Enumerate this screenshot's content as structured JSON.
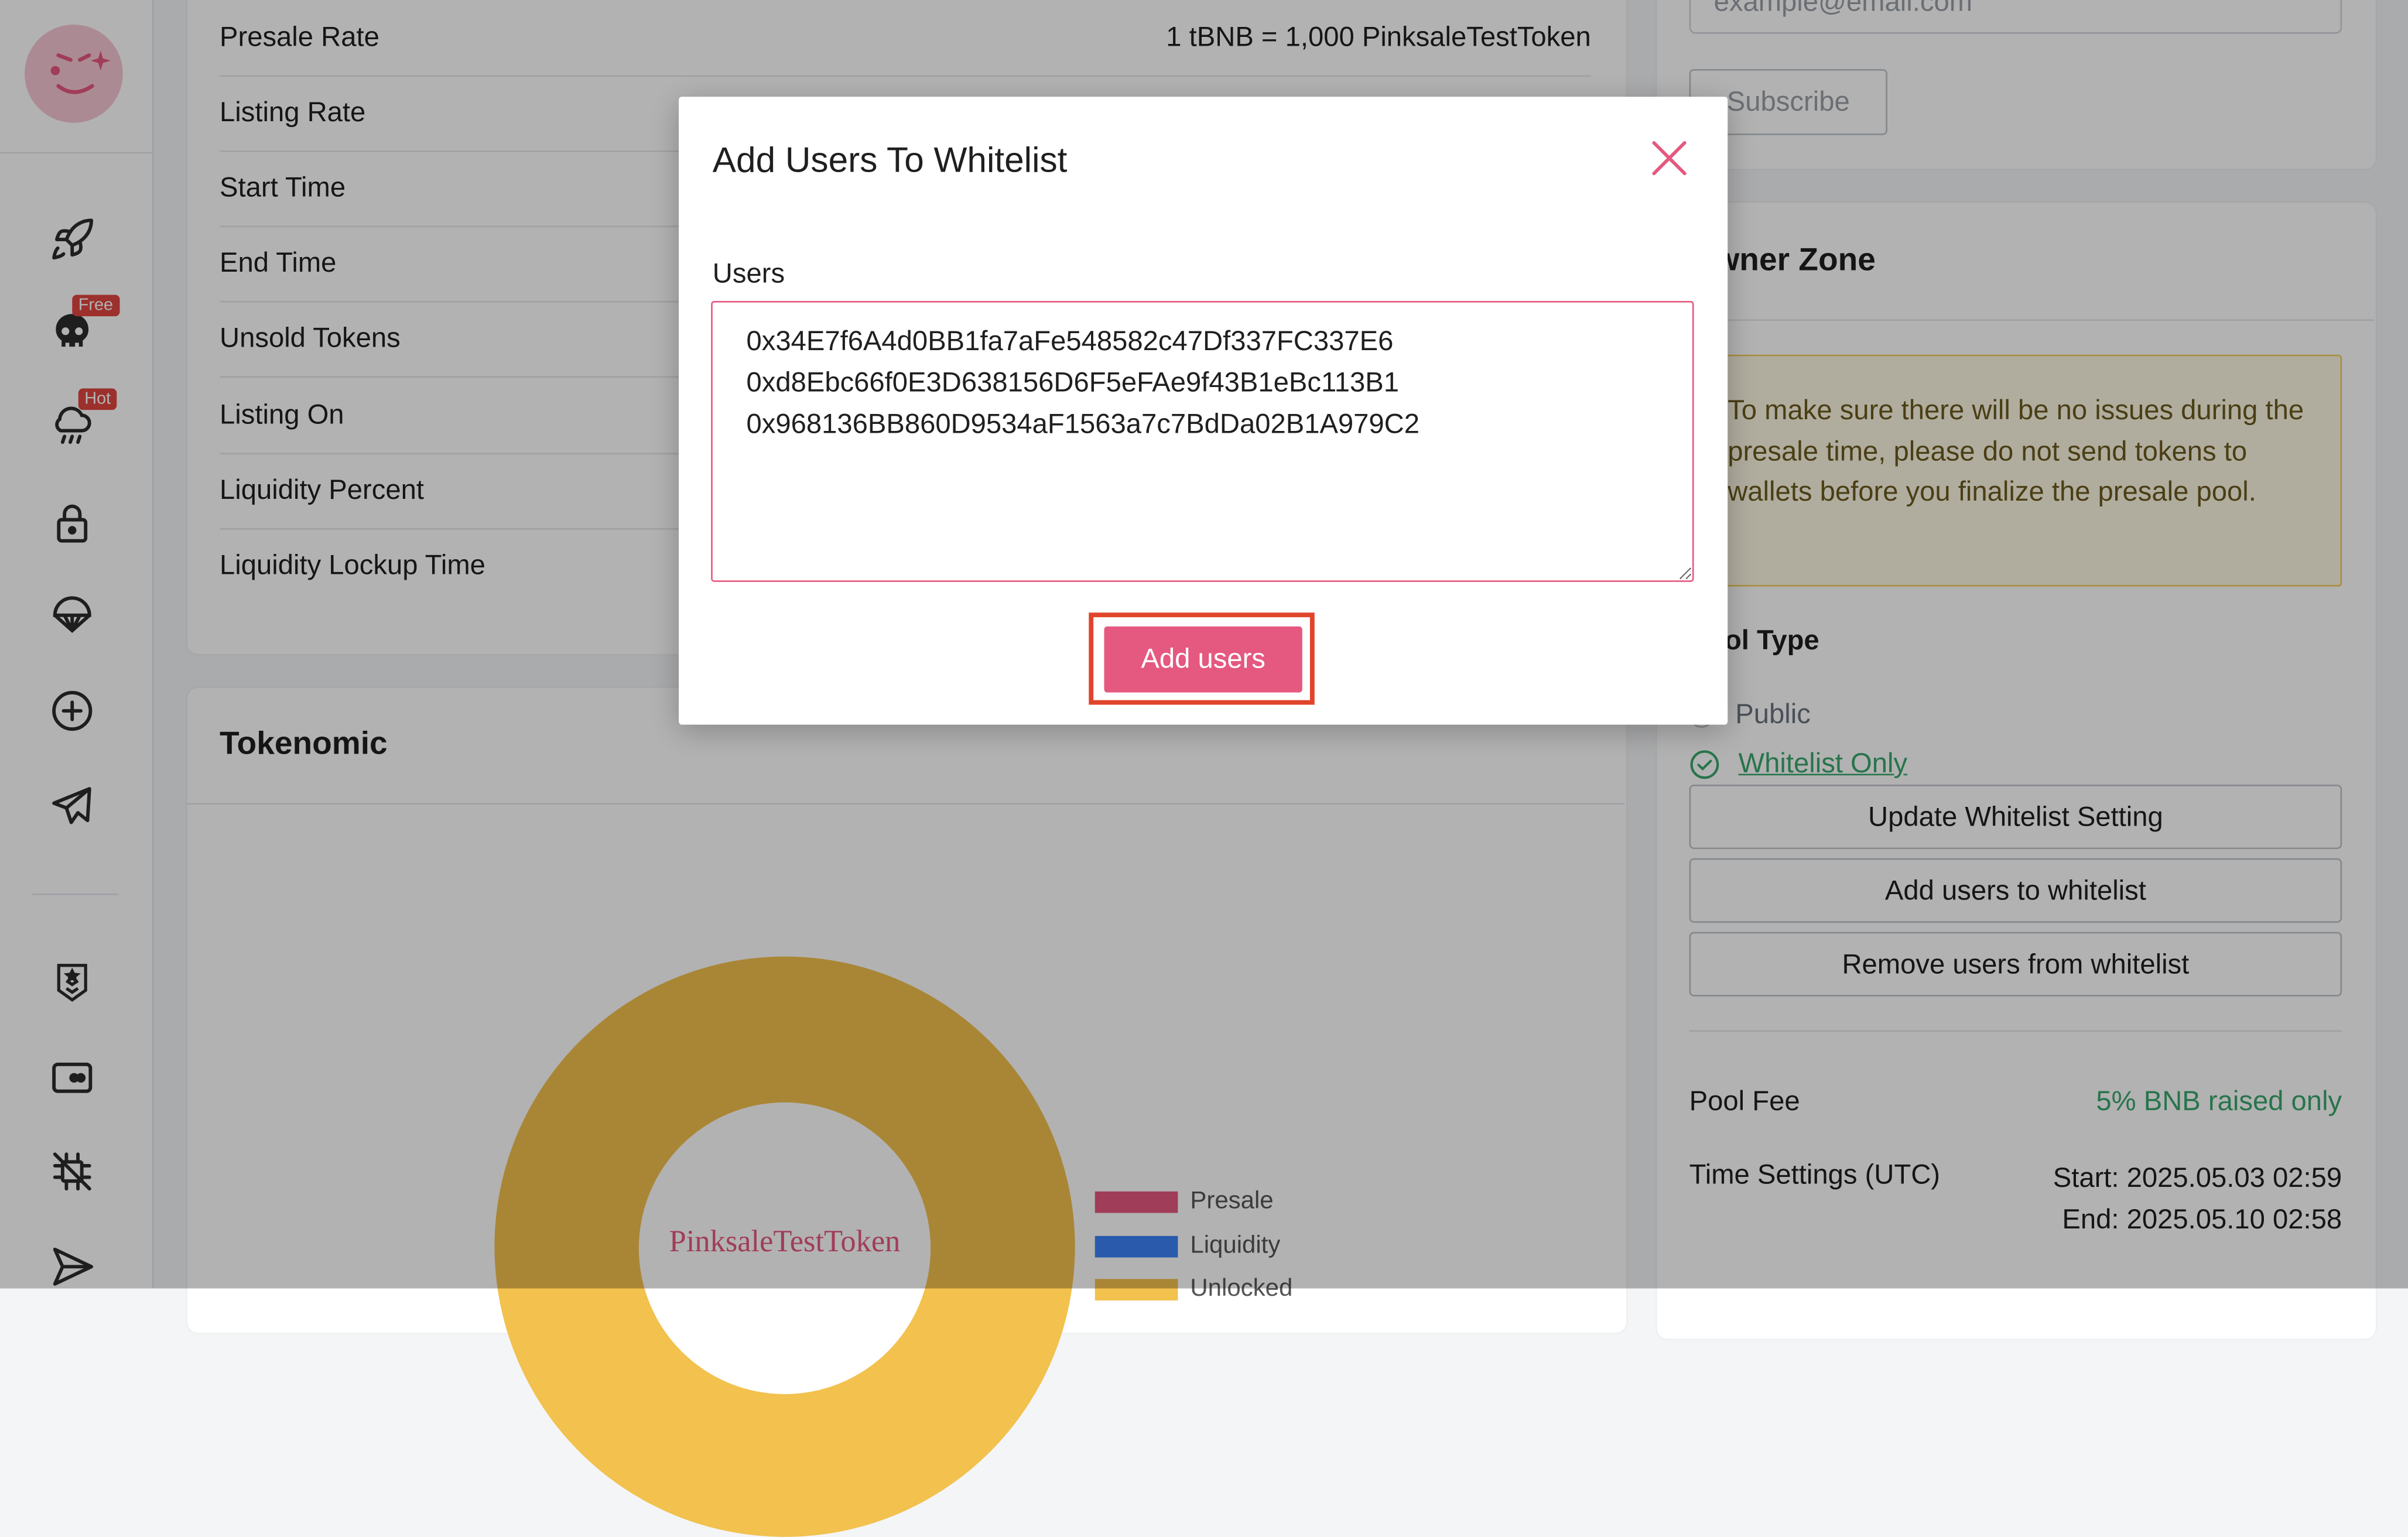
{
  "colors": {
    "accent": "#e5587f",
    "success": "#3aa76d",
    "warning_bg": "#fdf8e4",
    "highlight": "#e0452b"
  },
  "sidebar": {
    "items": [
      {
        "icon": "rocket-icon"
      },
      {
        "icon": "skull-icon",
        "badge": "Free"
      },
      {
        "icon": "storm-cloud-icon",
        "badge": "Hot"
      },
      {
        "icon": "lock-icon"
      },
      {
        "icon": "parachute-icon"
      },
      {
        "icon": "plus-circle-icon"
      },
      {
        "icon": "telegram-icon"
      },
      {
        "icon": "shield-badge-icon"
      },
      {
        "icon": "wallet-icon"
      },
      {
        "icon": "crossed-out-icon"
      },
      {
        "icon": "send-icon"
      }
    ]
  },
  "pool_info": {
    "rows": [
      {
        "label": "Presale Rate",
        "value": "1 tBNB = 1,000 PinksaleTestToken"
      },
      {
        "label": "Listing Rate",
        "value": ""
      },
      {
        "label": "Start Time",
        "value": ""
      },
      {
        "label": "End Time",
        "value": ""
      },
      {
        "label": "Unsold Tokens",
        "value": ""
      },
      {
        "label": "Listing On",
        "value": ""
      },
      {
        "label": "Liquidity Percent",
        "value": ""
      },
      {
        "label": "Liquidity Lockup Time",
        "value": ""
      }
    ]
  },
  "tokenomic": {
    "title": "Tokenomic",
    "center_label": "PinksaleTestToken",
    "legend": [
      {
        "label": "Presale",
        "color": "#e5587f"
      },
      {
        "label": "Liquidity",
        "color": "#3b82f6"
      },
      {
        "label": "Unlocked",
        "color": "#f2c14e"
      }
    ]
  },
  "newsletter": {
    "email_placeholder": "example@email.com",
    "subscribe_label": "Subscribe"
  },
  "owner_zone": {
    "title": "Owner Zone",
    "warning": "To make sure there will be no issues during the presale time, please do not send tokens to wallets before you finalize the presale pool.",
    "pool_type_label": "Pool Type",
    "option_public": "Public",
    "option_whitelist": "Whitelist Only",
    "update_whitelist_label": "Update Whitelist Setting",
    "add_users_label": "Add users to whitelist",
    "remove_users_label": "Remove users from whitelist",
    "pool_fee_label": "Pool Fee",
    "pool_fee_value": "5% BNB raised only",
    "time_settings_label": "Time Settings (UTC)",
    "start_value": "Start: 2025.05.03 02:59",
    "end_value": "End: 2025.05.10 02:58"
  },
  "modal": {
    "title": "Add Users To Whitelist",
    "users_label": "Users",
    "users_value": "0x34E7f6A4d0BB1fa7aFe548582c47Df337FC337E6\n0xd8Ebc66f0E3D638156D6F5eFAe9f43B1eBc113B1\n0x968136BB860D9534aF1563a7c7BdDa02B1A979C2",
    "submit_label": "Add users"
  }
}
